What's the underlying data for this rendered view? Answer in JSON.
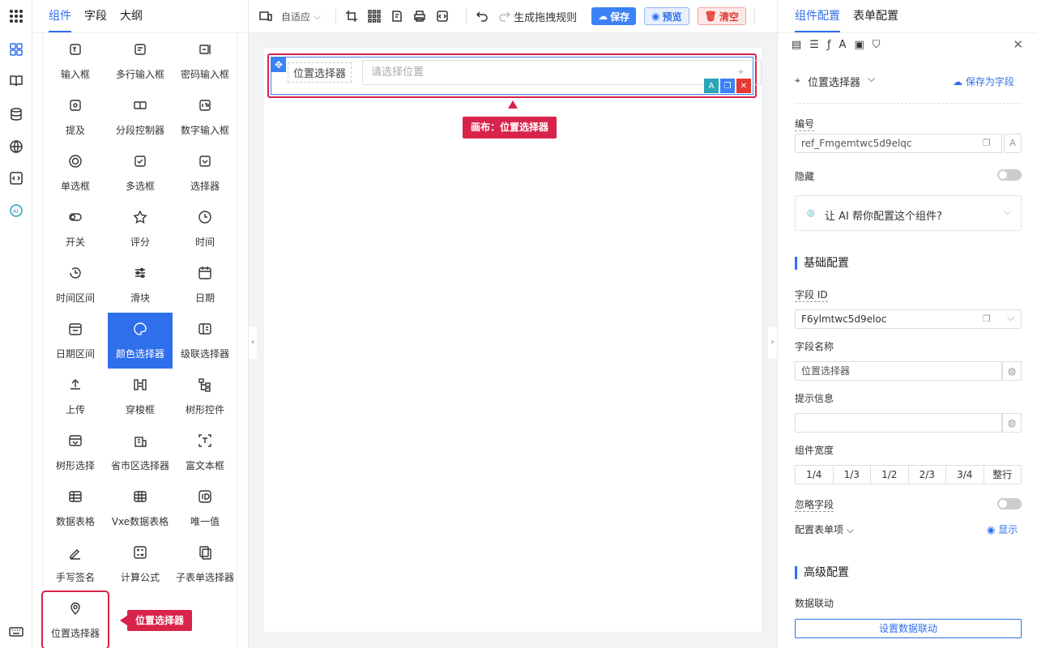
{
  "left_panel": {
    "tabs": [
      "组件",
      "字段",
      "大纲"
    ],
    "components": [
      {
        "label": "输入框",
        "icon": "input-icon"
      },
      {
        "label": "多行输入框",
        "icon": "textarea-icon"
      },
      {
        "label": "密码输入框",
        "icon": "password-icon"
      },
      {
        "label": "提及",
        "icon": "mention-icon"
      },
      {
        "label": "分段控制器",
        "icon": "segmented-icon"
      },
      {
        "label": "数字输入框",
        "icon": "number-icon"
      },
      {
        "label": "单选框",
        "icon": "radio-icon"
      },
      {
        "label": "多选框",
        "icon": "checkbox-icon"
      },
      {
        "label": "选择器",
        "icon": "select-icon"
      },
      {
        "label": "开关",
        "icon": "switch-icon"
      },
      {
        "label": "评分",
        "icon": "star-icon"
      },
      {
        "label": "时间",
        "icon": "clock-icon"
      },
      {
        "label": "时间区间",
        "icon": "time-range-icon"
      },
      {
        "label": "滑块",
        "icon": "slider-icon"
      },
      {
        "label": "日期",
        "icon": "calendar-icon"
      },
      {
        "label": "日期区间",
        "icon": "date-range-icon"
      },
      {
        "label": "颜色选择器",
        "icon": "palette-icon"
      },
      {
        "label": "级联选择器",
        "icon": "cascader-icon"
      },
      {
        "label": "上传",
        "icon": "upload-icon"
      },
      {
        "label": "穿梭框",
        "icon": "transfer-icon"
      },
      {
        "label": "树形控件",
        "icon": "tree-icon"
      },
      {
        "label": "树形选择",
        "icon": "tree-select-icon"
      },
      {
        "label": "省市区选择器",
        "icon": "region-icon"
      },
      {
        "label": "富文本框",
        "icon": "richtext-icon"
      },
      {
        "label": "数据表格",
        "icon": "table-icon"
      },
      {
        "label": "Vxe数据表格",
        "icon": "vxe-table-icon"
      },
      {
        "label": "唯一值",
        "icon": "id-icon"
      },
      {
        "label": "手写签名",
        "icon": "signature-icon"
      },
      {
        "label": "计算公式",
        "icon": "formula-icon"
      },
      {
        "label": "子表单选择器",
        "icon": "subform-icon"
      },
      {
        "label": "位置选择器",
        "icon": "location-icon"
      }
    ],
    "selected": "颜色选择器",
    "callout": "位置选择器"
  },
  "toolbar": {
    "adapt_label": "自适应",
    "generate_label": "生成拖拽规则",
    "save_label": "保存",
    "preview_label": "预览",
    "clear_label": "清空"
  },
  "canvas": {
    "field_label": "位置选择器",
    "field_placeholder": "请选择位置",
    "callout": "画布：位置选择器"
  },
  "right_panel": {
    "tabs": [
      "组件配置",
      "表单配置"
    ],
    "component_name": "位置选择器",
    "save_as_field": "保存为字段",
    "ref_label": "编号",
    "ref_value": "ref_Fmgemtwc5d9elqc",
    "hidden_label": "隐藏",
    "ai_prompt": "让 AI 帮你配置这个组件?",
    "basic_section": "基础配置",
    "field_id_label": "字段 ID",
    "field_id_value": "F6ylmtwc5d9eloc",
    "field_name_label": "字段名称",
    "field_name_value": "位置选择器",
    "hint_label": "提示信息",
    "hint_value": "",
    "width_label": "组件宽度",
    "width_options": [
      "1/4",
      "1/3",
      "1/2",
      "2/3",
      "3/4",
      "整行"
    ],
    "ignore_label": "忽略字段",
    "form_items_label": "配置表单项",
    "show_label": "显示",
    "advanced_section": "高级配置",
    "linkage_label": "数据联动",
    "linkage_button": "设置数据联动"
  },
  "colors": {
    "accent": "#2f6fec",
    "callout": "#d8234a"
  }
}
